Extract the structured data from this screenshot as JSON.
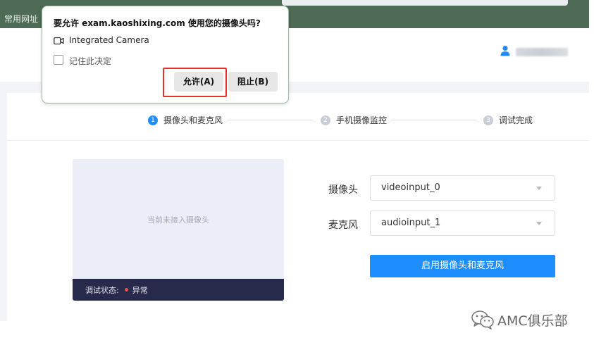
{
  "browser": {
    "bookmarks_label": "常用网址"
  },
  "permission_prompt": {
    "title": "要允许 exam.kaoshixing.com 使用您的摄像头吗?",
    "device_label": "Integrated Camera",
    "remember_label": "记住此决定",
    "allow_label": "允许(A)",
    "block_label": "阻止(B)"
  },
  "stepper": {
    "steps": [
      {
        "num": "1",
        "label": "摄像头和麦克风",
        "state": "active"
      },
      {
        "num": "2",
        "label": "手机摄像监控",
        "state": "pending"
      },
      {
        "num": "3",
        "label": "调试完成",
        "state": "pending"
      }
    ]
  },
  "preview": {
    "placeholder": "当前未接入摄像头",
    "status_label": "调试状态:",
    "status_value": "异常"
  },
  "form": {
    "camera_label": "摄像头",
    "camera_value": "videoinput_0",
    "mic_label": "麦克风",
    "mic_value": "audioinput_1",
    "enable_button": "启用摄像头和麦克风"
  },
  "watermark": {
    "text": "AMC俱乐部"
  },
  "colors": {
    "accent": "#1e8eff",
    "bookmarks_bar": "#4d6b55",
    "status_error": "#f04a4a",
    "highlight": "#e4322b"
  }
}
